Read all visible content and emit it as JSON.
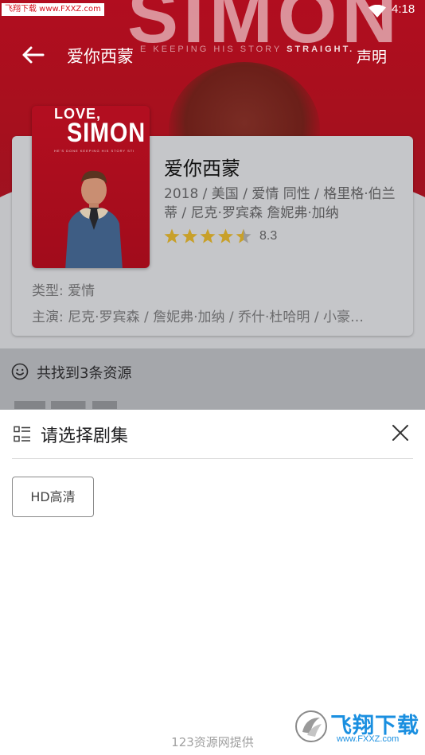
{
  "status_bar": {
    "watermark": "飞翔下载 www.FXXZ.com",
    "time": "4:18"
  },
  "hero": {
    "big_title": "SIMON",
    "tagline_start": "E KEEPING HIS STORY ",
    "tagline_bold": "STRAIGHT."
  },
  "toolbar": {
    "title": "爱你西蒙",
    "disclaimer": "声明"
  },
  "poster": {
    "love": "LOVE,",
    "simon": "SIMON",
    "tag": "HE'S DONE KEEPING HIS STORY STRAIGHT"
  },
  "movie": {
    "title": "爱你西蒙",
    "meta": "2018 / 美国 / 爱情 同性 / 格里格·伯兰蒂 / 尼克·罗宾森 詹妮弗·加纳",
    "rating": "8.3",
    "rating_value": 8.3,
    "stars_filled": 4.5,
    "star_color": "#c8a02a",
    "genre": "类型:  爱情",
    "cast": "主演:  尼克·罗宾森 / 詹妮弗·加纳 / 乔什·杜哈明 / 小豪…"
  },
  "results": {
    "text": "共找到3条资源"
  },
  "sheet": {
    "title": "请选择剧集",
    "episodes": [
      "HD高清"
    ],
    "provider": "123资源网提供"
  },
  "watermark_bottom": {
    "text": "飞翔下载",
    "url": "www.FXXZ.com"
  },
  "colors": {
    "accent": "#b10d1f",
    "watermark_blue": "#1a8fe0"
  }
}
